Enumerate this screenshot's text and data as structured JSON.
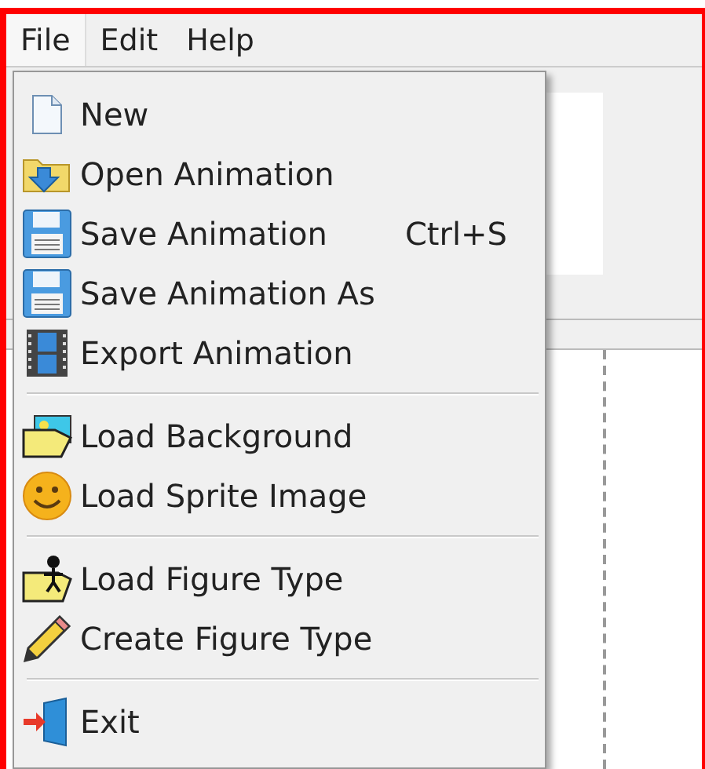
{
  "menu_bar": [
    {
      "label": "File",
      "selected": true
    },
    {
      "label": "Edit",
      "selected": false
    },
    {
      "label": "Help",
      "selected": false
    }
  ],
  "file_menu": [
    {
      "kind": "item",
      "label": "New"
    },
    {
      "kind": "item",
      "label": "Open Animation"
    },
    {
      "kind": "item",
      "label": "Save Animation",
      "shortcut": "Ctrl+S"
    },
    {
      "kind": "item",
      "label": "Save Animation As"
    },
    {
      "kind": "item",
      "label": "Export Animation"
    },
    {
      "kind": "separator"
    },
    {
      "kind": "item",
      "label": "Load Background"
    },
    {
      "kind": "item",
      "label": "Load Sprite Image"
    },
    {
      "kind": "separator"
    },
    {
      "kind": "item",
      "label": "Load Figure Type"
    },
    {
      "kind": "item",
      "label": "Create Figure Type"
    },
    {
      "kind": "separator"
    },
    {
      "kind": "item",
      "label": "Exit"
    }
  ]
}
